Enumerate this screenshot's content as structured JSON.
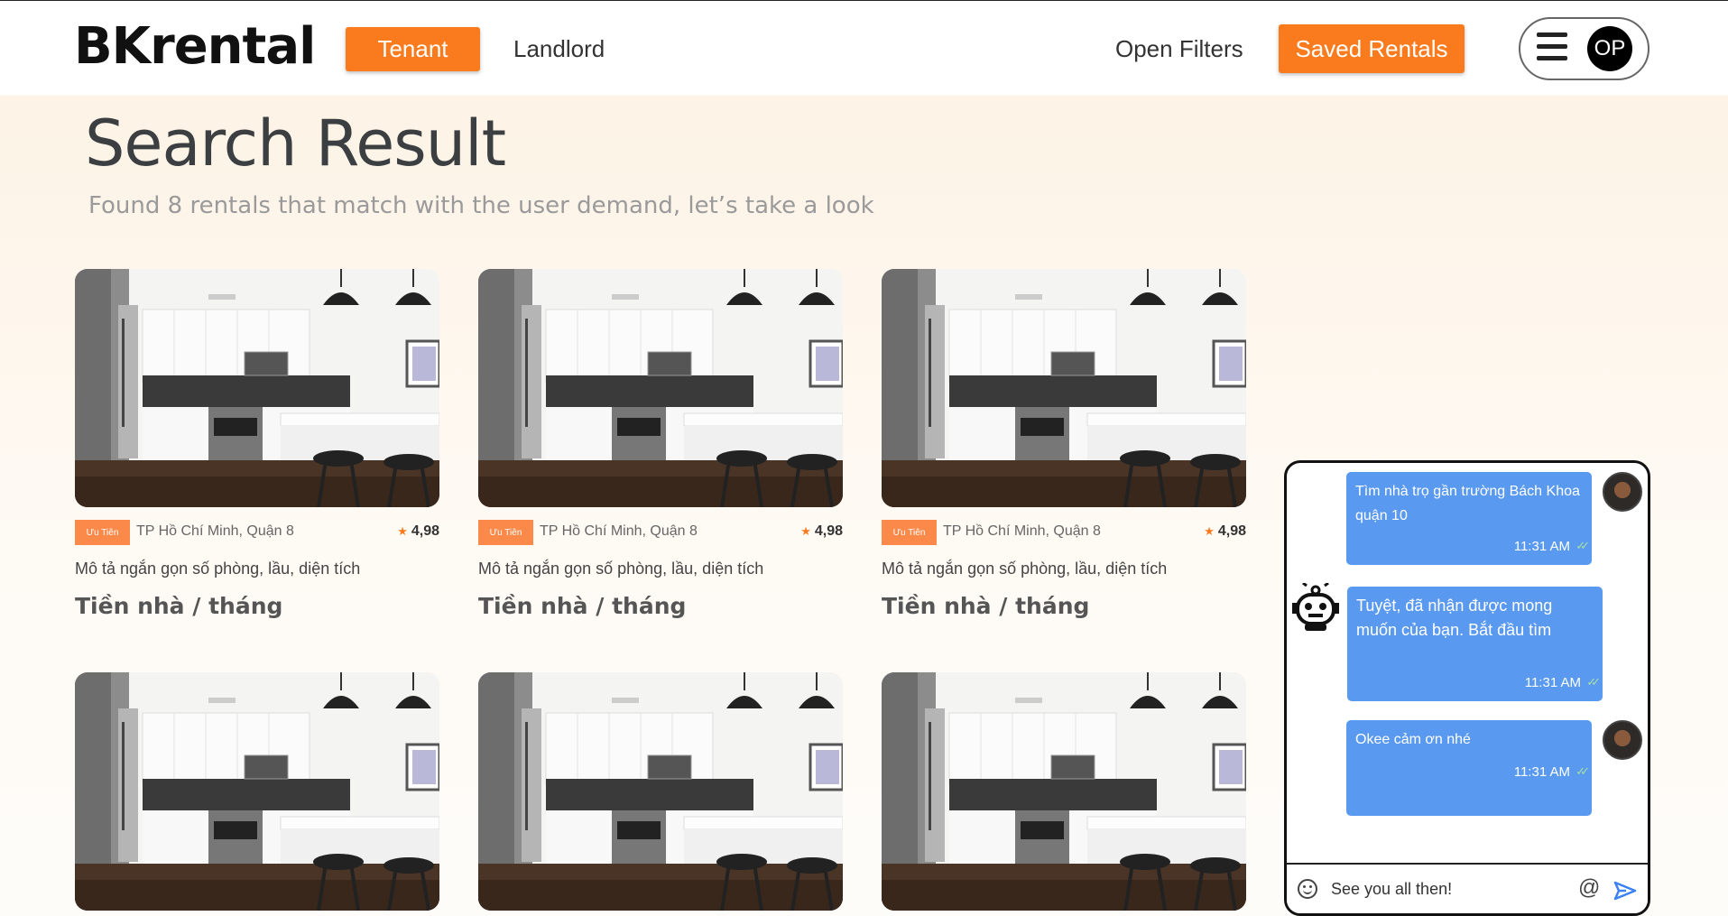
{
  "header": {
    "logo": "BKrental",
    "tab_tenant": "Tenant",
    "tab_landlord": "Landlord",
    "open_filters": "Open Filters",
    "saved_rentals": "Saved Rentals",
    "avatar_initials": "OP"
  },
  "page": {
    "title": "Search Result",
    "subtitle": "Found 8 rentals that match with the user demand, let’s take a look"
  },
  "cards": [
    {
      "badge": "Ưu Tiên",
      "location": "TP Hồ Chí Minh, Quận 8",
      "rating": "4,98",
      "desc": "Mô tả ngắn gọn số phòng, lầu, diện tích",
      "price": "Tiền nhà / tháng"
    },
    {
      "badge": "Ưu Tiên",
      "location": "TP Hồ Chí Minh, Quận 8",
      "rating": "4,98",
      "desc": "Mô tả ngắn gọn số phòng, lầu, diện tích",
      "price": "Tiền nhà / tháng"
    },
    {
      "badge": "Ưu Tiên",
      "location": "TP Hồ Chí Minh, Quận 8",
      "rating": "4,98",
      "desc": "Mô tả ngắn gọn số phòng, lầu, diện tích",
      "price": "Tiền nhà / tháng"
    }
  ],
  "chat": {
    "messages": [
      {
        "from": "user",
        "text": "Tìm nhà trọ gần trường Bách Khoa quận 10",
        "time": "11:31 AM"
      },
      {
        "from": "bot",
        "text": "Tuyệt, đã nhận được mong muốn của bạn. Bắt đầu tìm",
        "time": "11:31 AM"
      },
      {
        "from": "user",
        "text": "Okee cảm ơn nhé",
        "time": "11:31 AM"
      }
    ],
    "input_value": "See you all then!"
  },
  "icons": {
    "menu": "hamburger-icon",
    "star": "star-icon",
    "emoji": "smile-icon",
    "mention": "at-icon",
    "send": "send-icon",
    "bot": "robot-icon"
  },
  "colors": {
    "accent": "#fa7a1e",
    "bubble": "#5a99f0",
    "badge": "#fb8a4a"
  }
}
